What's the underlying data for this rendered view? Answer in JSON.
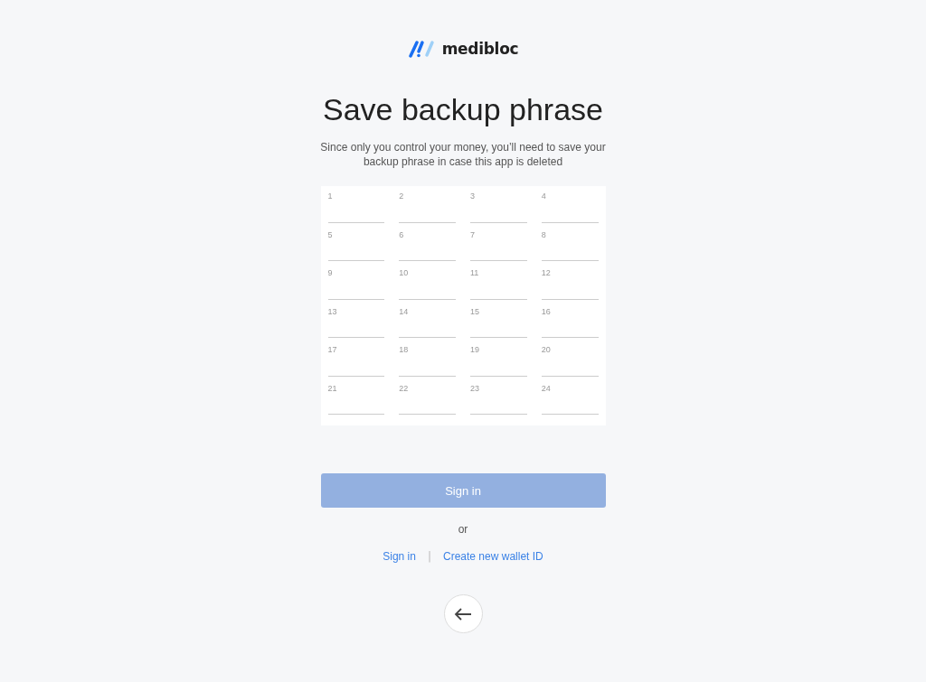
{
  "logo": {
    "text": "medibloc"
  },
  "title": "Save backup phrase",
  "subtitle": "Since only you control your money, you’ll need to save your backup phrase in case this app is deleted",
  "words": [
    {
      "label": "1"
    },
    {
      "label": "2"
    },
    {
      "label": "3"
    },
    {
      "label": "4"
    },
    {
      "label": "5"
    },
    {
      "label": "6"
    },
    {
      "label": "7"
    },
    {
      "label": "8"
    },
    {
      "label": "9"
    },
    {
      "label": "10"
    },
    {
      "label": "11"
    },
    {
      "label": "12"
    },
    {
      "label": "13"
    },
    {
      "label": "14"
    },
    {
      "label": "15"
    },
    {
      "label": "16"
    },
    {
      "label": "17"
    },
    {
      "label": "18"
    },
    {
      "label": "19"
    },
    {
      "label": "20"
    },
    {
      "label": "21"
    },
    {
      "label": "22"
    },
    {
      "label": "23"
    },
    {
      "label": "24"
    }
  ],
  "primary_button": {
    "label": "Sign in",
    "disabled": true
  },
  "or_text": "or",
  "links": [
    {
      "label": "Sign in"
    },
    {
      "label": "Create new wallet ID"
    }
  ],
  "separator": "|"
}
